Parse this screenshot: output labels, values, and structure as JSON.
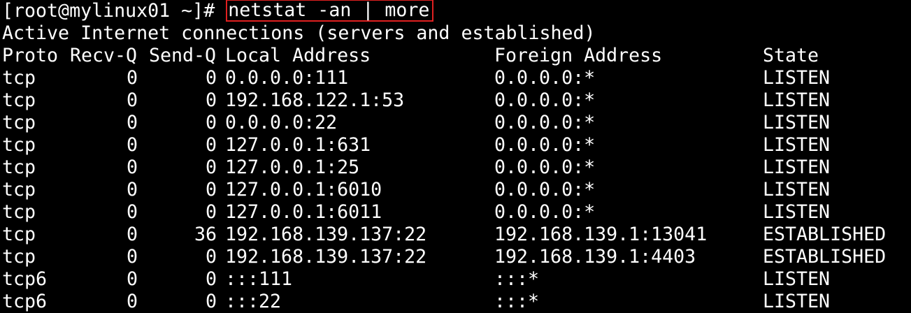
{
  "prompt": {
    "user_host": "[root@mylinux01 ~]# ",
    "command": "netstat -an | more"
  },
  "banner": "Active Internet connections (servers and established)",
  "table": {
    "headers": {
      "proto": "Proto",
      "recv_q": "Recv-Q",
      "send_q": "Send-Q",
      "local": "Local Address",
      "foreign": "Foreign Address",
      "state": "State"
    },
    "rows": [
      {
        "proto": "tcp",
        "recv_q": "0",
        "send_q": "0",
        "local": "0.0.0.0:111",
        "foreign": "0.0.0.0:*",
        "state": "LISTEN"
      },
      {
        "proto": "tcp",
        "recv_q": "0",
        "send_q": "0",
        "local": "192.168.122.1:53",
        "foreign": "0.0.0.0:*",
        "state": "LISTEN"
      },
      {
        "proto": "tcp",
        "recv_q": "0",
        "send_q": "0",
        "local": "0.0.0.0:22",
        "foreign": "0.0.0.0:*",
        "state": "LISTEN"
      },
      {
        "proto": "tcp",
        "recv_q": "0",
        "send_q": "0",
        "local": "127.0.0.1:631",
        "foreign": "0.0.0.0:*",
        "state": "LISTEN"
      },
      {
        "proto": "tcp",
        "recv_q": "0",
        "send_q": "0",
        "local": "127.0.0.1:25",
        "foreign": "0.0.0.0:*",
        "state": "LISTEN"
      },
      {
        "proto": "tcp",
        "recv_q": "0",
        "send_q": "0",
        "local": "127.0.0.1:6010",
        "foreign": "0.0.0.0:*",
        "state": "LISTEN"
      },
      {
        "proto": "tcp",
        "recv_q": "0",
        "send_q": "0",
        "local": "127.0.0.1:6011",
        "foreign": "0.0.0.0:*",
        "state": "LISTEN"
      },
      {
        "proto": "tcp",
        "recv_q": "0",
        "send_q": "36",
        "local": "192.168.139.137:22",
        "foreign": "192.168.139.1:13041",
        "state": "ESTABLISHED"
      },
      {
        "proto": "tcp",
        "recv_q": "0",
        "send_q": "0",
        "local": "192.168.139.137:22",
        "foreign": "192.168.139.1:4403",
        "state": "ESTABLISHED"
      },
      {
        "proto": "tcp6",
        "recv_q": "0",
        "send_q": "0",
        "local": ":::111",
        "foreign": ":::*",
        "state": "LISTEN"
      },
      {
        "proto": "tcp6",
        "recv_q": "0",
        "send_q": "0",
        "local": ":::22",
        "foreign": ":::*",
        "state": "LISTEN"
      }
    ]
  },
  "colors": {
    "background": "#000000",
    "text": "#ffffff",
    "highlight_border": "#e02020"
  }
}
